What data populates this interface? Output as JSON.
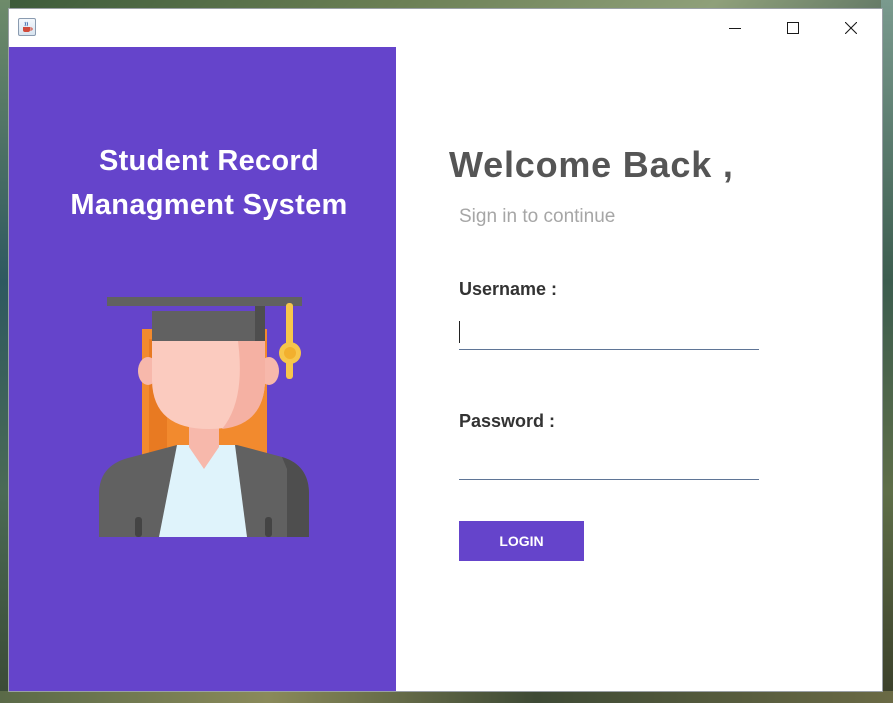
{
  "window": {
    "icon": "java-cup-icon",
    "controls": [
      "minimize-icon",
      "maximize-icon",
      "close-icon"
    ]
  },
  "branding": {
    "title_line1": "Student Record",
    "title_line2": "Managment System",
    "illustration": "graduate-student-icon",
    "panel_color": "#6544cb"
  },
  "login": {
    "heading": "Welcome Back ,",
    "subheading": "Sign in to continue",
    "username_label": "Username :",
    "username_value": "",
    "password_label": "Password :",
    "password_value": "",
    "submit_label": "LOGIN",
    "accent_color": "#6544cb"
  }
}
